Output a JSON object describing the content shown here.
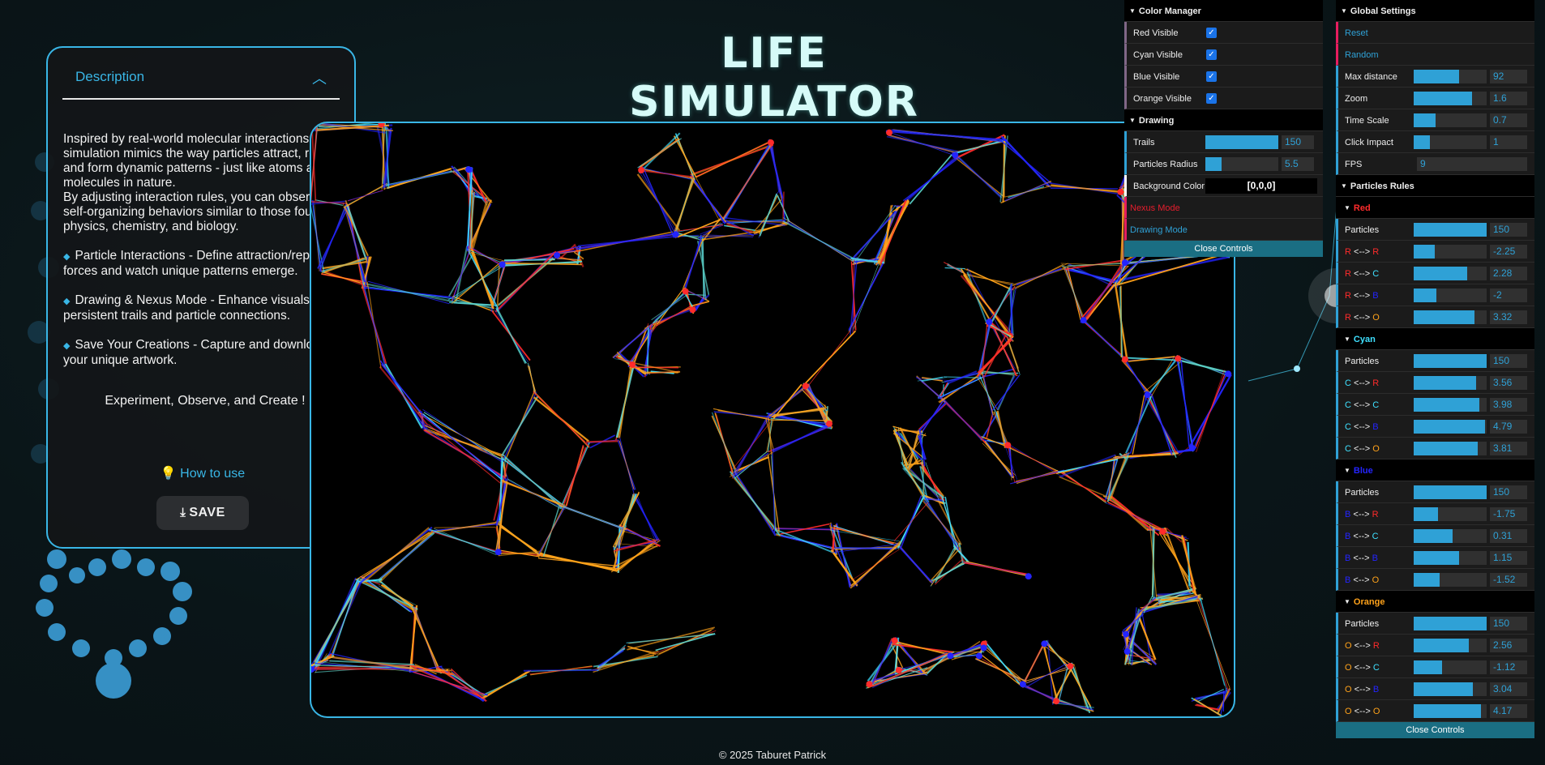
{
  "title": "LIFE SIMULATOR",
  "description": {
    "header": "Description",
    "paragraphs": [
      "Inspired by real-world molecular interactions, this simulation mimics the way particles attract, repel, and form dynamic patterns - just like atoms and molecules in nature.",
      "By adjusting interaction rules, you can observe self-organizing behaviors similar to those found in physics, chemistry, and biology."
    ],
    "features": [
      "Particle Interactions - Define attraction/repulsion forces and watch unique patterns emerge.",
      "Drawing & Nexus Mode - Enhance visuals with persistent trails and particle connections.",
      "Save Your Creations - Capture and download your unique artwork."
    ],
    "tagline": "Experiment, Observe, and Create !",
    "how_to_use": "How to use",
    "save_label": "SAVE"
  },
  "footer": "© 2025 Taburet Patrick",
  "color_manager": {
    "header": "Color Manager",
    "items": [
      {
        "label": "Red Visible",
        "checked": true
      },
      {
        "label": "Cyan Visible",
        "checked": true
      },
      {
        "label": "Blue Visible",
        "checked": true
      },
      {
        "label": "Orange Visible",
        "checked": true
      }
    ]
  },
  "drawing": {
    "header": "Drawing",
    "trails": {
      "label": "Trails",
      "value": "150",
      "fill": 1.0
    },
    "radius": {
      "label": "Particles Radius",
      "value": "5.5",
      "fill": 0.22
    },
    "background": {
      "label": "Background Color",
      "value": "[0,0,0]"
    },
    "nexus_mode": "Nexus Mode",
    "drawing_mode": "Drawing Mode",
    "close": "Close Controls"
  },
  "global": {
    "header": "Global Settings",
    "reset": "Reset",
    "random": "Random",
    "sliders": [
      {
        "label": "Max distance",
        "value": "92",
        "fill": 0.62
      },
      {
        "label": "Zoom",
        "value": "1.6",
        "fill": 0.8
      },
      {
        "label": "Time Scale",
        "value": "0.7",
        "fill": 0.3
      },
      {
        "label": "Click Impact",
        "value": "1",
        "fill": 0.22
      }
    ],
    "fps_label": "FPS",
    "fps_value": "9"
  },
  "rules": {
    "header": "Particles Rules",
    "close": "Close Controls",
    "arrow": "<-->",
    "groups": [
      {
        "name": "Red",
        "key": "R",
        "particles": "150",
        "rules": [
          {
            "to": "R",
            "value": "-2.25",
            "fill": 0.29
          },
          {
            "to": "C",
            "value": "2.28",
            "fill": 0.73
          },
          {
            "to": "B",
            "value": "-2",
            "fill": 0.31
          },
          {
            "to": "O",
            "value": "3.32",
            "fill": 0.83
          }
        ]
      },
      {
        "name": "Cyan",
        "key": "C",
        "particles": "150",
        "rules": [
          {
            "to": "R",
            "value": "3.56",
            "fill": 0.86
          },
          {
            "to": "C",
            "value": "3.98",
            "fill": 0.9
          },
          {
            "to": "B",
            "value": "4.79",
            "fill": 0.98
          },
          {
            "to": "O",
            "value": "3.81",
            "fill": 0.88
          }
        ]
      },
      {
        "name": "Blue",
        "key": "B",
        "particles": "150",
        "rules": [
          {
            "to": "R",
            "value": "-1.75",
            "fill": 0.33
          },
          {
            "to": "C",
            "value": "0.31",
            "fill": 0.53
          },
          {
            "to": "B",
            "value": "1.15",
            "fill": 0.62
          },
          {
            "to": "O",
            "value": "-1.52",
            "fill": 0.35
          }
        ]
      },
      {
        "name": "Orange",
        "key": "O",
        "particles": "150",
        "rules": [
          {
            "to": "R",
            "value": "2.56",
            "fill": 0.76
          },
          {
            "to": "C",
            "value": "-1.12",
            "fill": 0.39
          },
          {
            "to": "B",
            "value": "3.04",
            "fill": 0.81
          },
          {
            "to": "O",
            "value": "4.17",
            "fill": 0.92
          }
        ]
      }
    ]
  },
  "colors": {
    "red": "#ff2b2b",
    "cyan": "#3fe0ff",
    "blue": "#2424ff",
    "orange": "#ffa21a",
    "accent": "#39b6e6"
  }
}
